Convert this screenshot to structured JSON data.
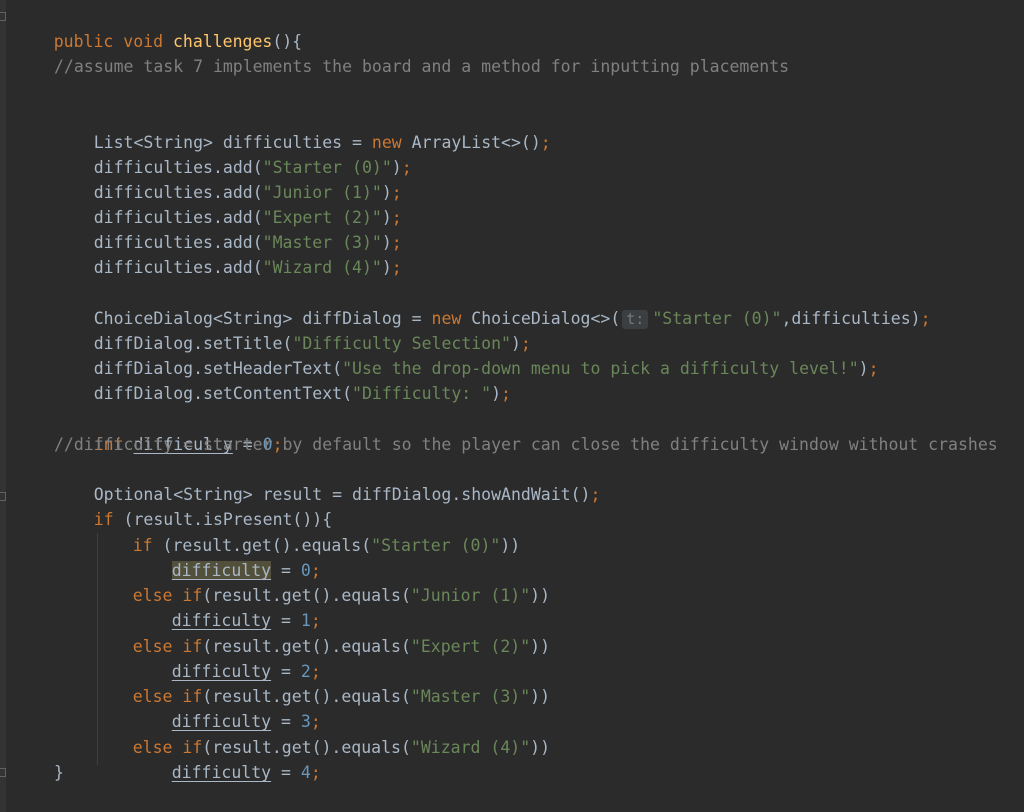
{
  "editor": {
    "line1": {
      "kw": "public void ",
      "fn": "challenges",
      "rest": "(){"
    },
    "comment1": "//assume task 7 implements the board and a method for inputting placements",
    "list_decl": {
      "a": "List<String> difficulties = ",
      "kw": "new",
      "b": " ArrayList<>()",
      "semi": ";"
    },
    "adds": [
      {
        "call": "difficulties.add(",
        "str": "\"Starter (0)\"",
        "end": ")"
      },
      {
        "call": "difficulties.add(",
        "str": "\"Junior (1)\"",
        "end": ")"
      },
      {
        "call": "difficulties.add(",
        "str": "\"Expert (2)\"",
        "end": ")"
      },
      {
        "call": "difficulties.add(",
        "str": "\"Master (3)\"",
        "end": ")"
      },
      {
        "call": "difficulties.add(",
        "str": "\"Wizard (4)\"",
        "end": ")"
      }
    ],
    "dialog_decl": {
      "a": "ChoiceDialog<String> diffDialog = ",
      "kw": "new",
      "b": " ChoiceDialog<>(",
      "hint": "t:",
      "str": "\"Starter (0)\"",
      "c": ",difficulties)"
    },
    "set_title": {
      "call": "diffDialog.setTitle(",
      "str": "\"Difficulty Selection\"",
      "end": ")"
    },
    "set_header": {
      "call": "diffDialog.setHeaderText(",
      "str": "\"Use the drop-down menu to pick a difficulty level!\"",
      "end": ")"
    },
    "set_content": {
      "call": "diffDialog.setContentText(",
      "str": "\"Difficulty: \"",
      "end": ")"
    },
    "int_decl": {
      "kw": "int ",
      "var": "difficulty",
      "eq": " = ",
      "num": "0"
    },
    "comment2": "//difficulty = starter by default so the player can close the difficulty window without crashes",
    "optional_decl": "Optional<String> result = diffDialog.showAndWait()",
    "if_present": {
      "kw": "if",
      "rest": " (result.isPresent()){"
    },
    "branches": [
      {
        "kw": "if",
        "rest": " (result.get().equals(",
        "str": "\"Starter (0)\"",
        "end": "))",
        "var": "difficulty",
        "num": "0"
      },
      {
        "kw": "else if",
        "rest": "(result.get().equals(",
        "str": "\"Junior (1)\"",
        "end": "))",
        "var": "difficulty",
        "num": "1"
      },
      {
        "kw": "else if",
        "rest": "(result.get().equals(",
        "str": "\"Expert (2)\"",
        "end": "))",
        "var": "difficulty",
        "num": "2"
      },
      {
        "kw": "else if",
        "rest": "(result.get().equals(",
        "str": "\"Master (3)\"",
        "end": "))",
        "var": "difficulty",
        "num": "3"
      },
      {
        "kw": "else if",
        "rest": "(result.get().equals(",
        "str": "\"Wizard (4)\"",
        "end": "))",
        "var": "difficulty",
        "num": "4"
      }
    ],
    "close_brace": "}",
    "semi": ";",
    "assign_eq": " = "
  },
  "colors": {
    "background": "#2b2b2b",
    "keyword": "#cc7832",
    "function": "#ffc66d",
    "string": "#6a8759",
    "number": "#6897bb",
    "comment": "#808080",
    "text": "#a9b7c6"
  }
}
